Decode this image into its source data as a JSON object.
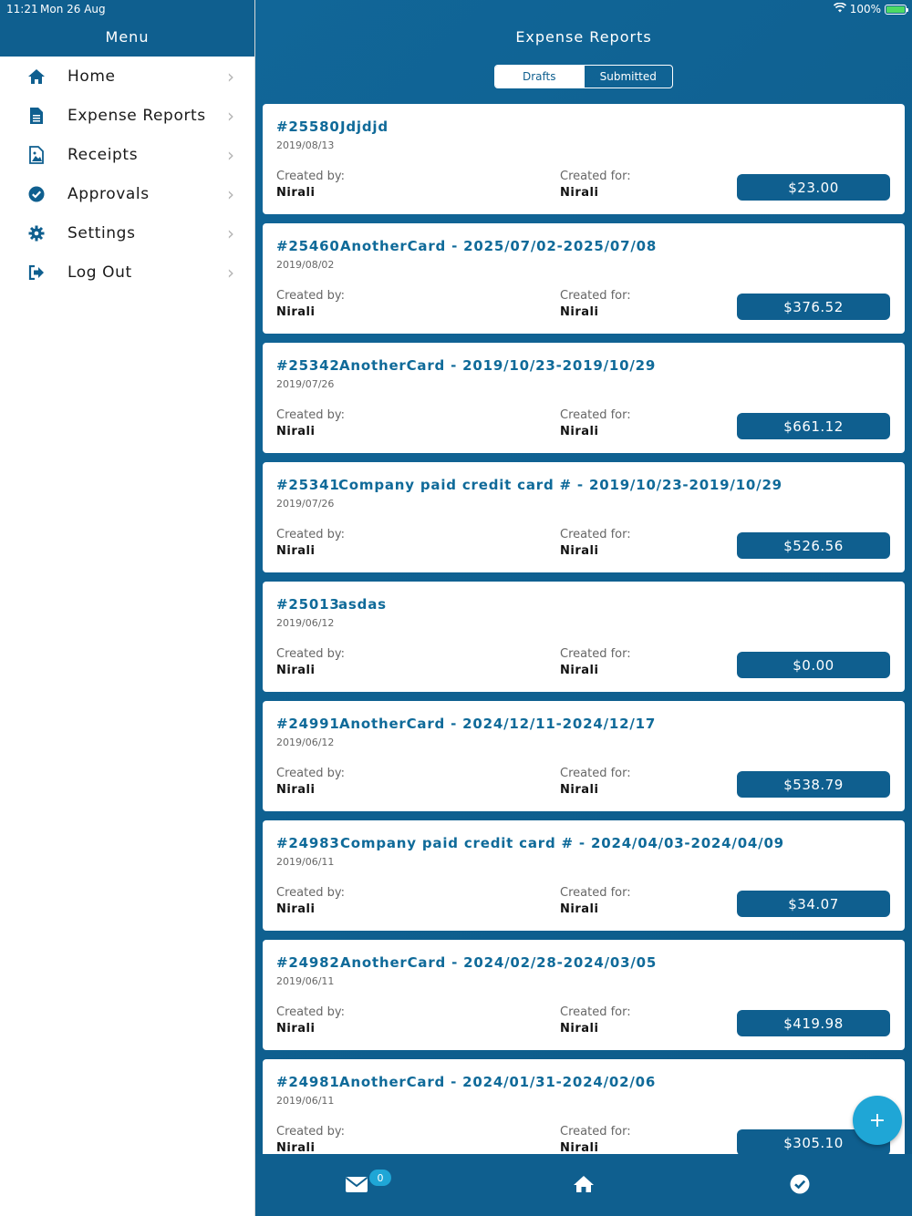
{
  "status_bar": {
    "time": "11:21",
    "date": "Mon 26 Aug",
    "battery": "100%"
  },
  "menu": {
    "title": "Menu",
    "items": [
      {
        "label": "Home",
        "icon": "home-icon"
      },
      {
        "label": "Expense Reports",
        "icon": "document-icon"
      },
      {
        "label": "Receipts",
        "icon": "image-icon"
      },
      {
        "label": "Approvals",
        "icon": "check-circle-icon"
      },
      {
        "label": "Settings",
        "icon": "gear-icon"
      },
      {
        "label": "Log Out",
        "icon": "logout-icon"
      }
    ]
  },
  "main": {
    "title": "Expense Reports",
    "segments": {
      "drafts": "Drafts",
      "submitted": "Submitted",
      "active": "drafts"
    },
    "labels": {
      "created_by": "Created by:",
      "created_for": "Created for:"
    },
    "reports": [
      {
        "number": "#25580",
        "name": "Jdjdjd",
        "date": "2019/08/13",
        "created_by": "Nirali",
        "created_for": "Nirali",
        "amount": "$23.00"
      },
      {
        "number": "#25460",
        "name": "AnotherCard - 2025/07/02-2025/07/08",
        "date": "2019/08/02",
        "created_by": "Nirali",
        "created_for": "Nirali",
        "amount": "$376.52"
      },
      {
        "number": "#25342",
        "name": "AnotherCard - 2019/10/23-2019/10/29",
        "date": "2019/07/26",
        "created_by": "Nirali",
        "created_for": "Nirali",
        "amount": "$661.12"
      },
      {
        "number": "#25341",
        "name": "Company paid credit card # - 2019/10/23-2019/10/29",
        "date": "2019/07/26",
        "created_by": "Nirali",
        "created_for": "Nirali",
        "amount": "$526.56"
      },
      {
        "number": "#25013",
        "name": "asdas",
        "date": "2019/06/12",
        "created_by": "Nirali",
        "created_for": "Nirali",
        "amount": "$0.00"
      },
      {
        "number": "#24991",
        "name": "AnotherCard - 2024/12/11-2024/12/17",
        "date": "2019/06/12",
        "created_by": "Nirali",
        "created_for": "Nirali",
        "amount": "$538.79"
      },
      {
        "number": "#24983",
        "name": "Company paid credit card # - 2024/04/03-2024/04/09",
        "date": "2019/06/11",
        "created_by": "Nirali",
        "created_for": "Nirali",
        "amount": "$34.07"
      },
      {
        "number": "#24982",
        "name": "AnotherCard - 2024/02/28-2024/03/05",
        "date": "2019/06/11",
        "created_by": "Nirali",
        "created_for": "Nirali",
        "amount": "$419.98"
      },
      {
        "number": "#24981",
        "name": "AnotherCard - 2024/01/31-2024/02/06",
        "date": "2019/06/11",
        "created_by": "Nirali",
        "created_for": "Nirali",
        "amount": "$305.10"
      }
    ],
    "fab_label": "+"
  },
  "tabbar": {
    "inbox_badge": "0",
    "icons": [
      "mail-icon",
      "home-icon",
      "check-circle-icon"
    ]
  },
  "colors": {
    "primary": "#0f5f8f",
    "accent": "#1fa6d6",
    "card": "#ffffff"
  }
}
